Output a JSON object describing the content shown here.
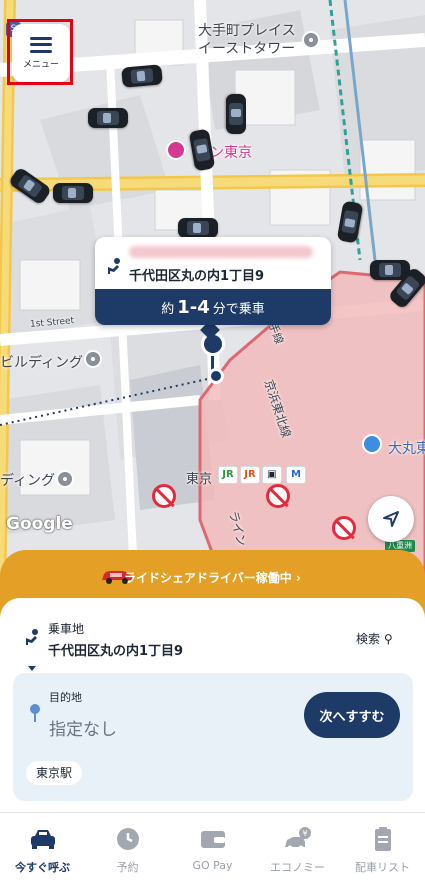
{
  "map": {
    "building_label_1": "大手町プレイス",
    "building_label_2": "イーストタワー",
    "hotel_label": "マン東京",
    "building_left_1": "ビルディング",
    "building_left_2": "ディング",
    "street_label": "1st Street",
    "station_label": "東京",
    "right_label": "大丸東",
    "rail_label": "京浜東北線",
    "rail_label_2": "ライン",
    "rail_label_3": "山手線",
    "small_badge": "S",
    "exit_badge": "八重洲",
    "google": "Google"
  },
  "menu": {
    "label": "メニュー",
    "icon": "hamburger-icon"
  },
  "pickup_card": {
    "address": "千代田区丸の内1丁目9",
    "eta_prefix": "約",
    "eta_value": "1-4",
    "eta_suffix": "分で乗車"
  },
  "banner": {
    "text": "ライドシェアドライバー稼働中 ›"
  },
  "sheet": {
    "pickup_label": "乗車地",
    "pickup_address": "千代田区丸の内1丁目9",
    "search_label": "検索 ⚲",
    "dest_label": "目的地",
    "dest_placeholder": "指定なし",
    "next_button": "次へすすむ",
    "suggestion_chip": "東京駅"
  },
  "tabs": [
    {
      "label": "今すぐ呼ぶ",
      "icon": "taxi-icon",
      "active": true
    },
    {
      "label": "予約",
      "icon": "clock-icon",
      "active": false
    },
    {
      "label": "GO Pay",
      "icon": "wallet-icon",
      "active": false
    },
    {
      "label": "エコノミー",
      "icon": "economy-car-icon",
      "active": false
    },
    {
      "label": "配車リスト",
      "icon": "clipboard-icon",
      "active": false
    }
  ],
  "colors": {
    "navy": "#1e3a67",
    "banner": "#e4a026",
    "zone_fill": "#f3b8b8",
    "zone_stroke": "#e0676f",
    "highlight": "#e60012"
  }
}
